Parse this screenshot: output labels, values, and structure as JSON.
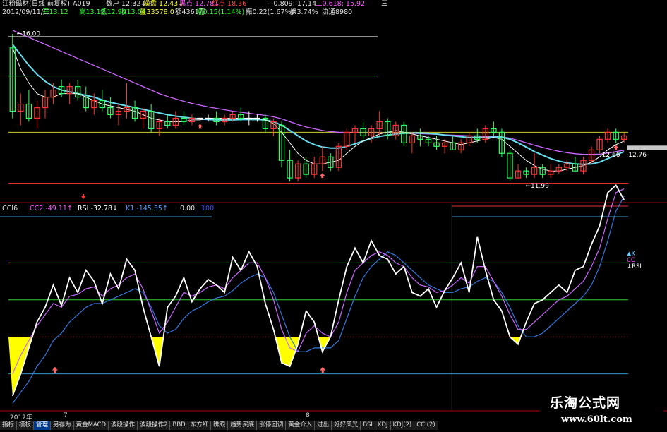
{
  "header": {
    "line1": [
      {
        "text": "江粉磁材(日线 前复权)",
        "color": "#e0e0e0"
      },
      {
        "text": "A019",
        "color": "#e0e0e0"
      },
      {
        "text": "数户 12:32↓",
        "color": "#e0e0e0"
      },
      {
        "text": "操盘 12.43↓",
        "color": "#ffff33"
      },
      {
        "text": "黑点 12.78↓",
        "color": "#ff55ff"
      },
      {
        "text": "红点 18.36",
        "color": "#ff4444"
      },
      {
        "text": "—0.809: 17.14",
        "color": "#e0e0e0"
      },
      {
        "text": "二0.618: 15.92",
        "color": "#ff55ff"
      },
      {
        "text": "三",
        "color": "#e0e0e0"
      }
    ],
    "line2": [
      {
        "text": "2012/09/11/二",
        "color": "#e0e0e0"
      },
      {
        "text": "开13.12",
        "color": "#33ff33"
      },
      {
        "text": "高13.12",
        "color": "#33ff33"
      },
      {
        "text": "低12.90",
        "color": "#33ff33"
      },
      {
        "text": "收13.04",
        "color": "#33ff33"
      },
      {
        "text": "量33578.0",
        "color": "#ffff33"
      },
      {
        "text": "额4361万",
        "color": "#e0e0e0"
      },
      {
        "text": "幅0.15(1.14%)",
        "color": "#33ff33"
      },
      {
        "text": "振0.22(1.67%)",
        "color": "#e0e0e0"
      },
      {
        "text": "换3.74%",
        "color": "#e0e0e0"
      },
      {
        "text": "流通8980",
        "color": "#e0e0e0"
      }
    ]
  },
  "indicator_header": [
    {
      "text": "CCI6",
      "color": "#e0e0e0"
    },
    {
      "text": "CC2 -49.11↑",
      "color": "#ff55ff"
    },
    {
      "text": "RSI -32.78↓",
      "color": "#ffffff"
    },
    {
      "text": "K1 -145.35↑",
      "color": "#5599ff"
    },
    {
      "text": "0.00",
      "color": "#e0e0e0"
    },
    {
      "text": "100",
      "color": "#3355ff"
    }
  ],
  "axis_labels": {
    "year": "2012年",
    "m7": "7",
    "m8": "8"
  },
  "tabs": [
    {
      "label": "指标",
      "active": false
    },
    {
      "label": "模板",
      "active": false
    },
    {
      "label": "管理",
      "active": true
    },
    {
      "label": "另存为",
      "active": false
    },
    {
      "label": "黄金MACD",
      "active": false
    },
    {
      "label": "波段操作",
      "active": false
    },
    {
      "label": "波段操作2",
      "active": false
    },
    {
      "label": "BBD",
      "active": false
    },
    {
      "label": "东方红",
      "active": false
    },
    {
      "label": "瞧眼",
      "active": false
    },
    {
      "label": "趋势买底",
      "active": false
    },
    {
      "label": "涨停回调",
      "active": false
    },
    {
      "label": "黄金介入",
      "active": false
    },
    {
      "label": "进出",
      "active": false
    },
    {
      "label": "好好风光",
      "active": false
    },
    {
      "label": "BSI",
      "active": false
    },
    {
      "label": "KDJ",
      "active": false
    },
    {
      "label": "KDJ(2)",
      "active": false
    },
    {
      "label": "CCI(2)",
      "active": false
    }
  ],
  "watermark": {
    "title": "乐淘公式网",
    "url": "www.60lt.com"
  },
  "chart_data": [
    {
      "type": "candlestick",
      "title": "江粉磁材(日线 前复权)",
      "ylim": [
        11.3,
        16.4
      ],
      "annotations": [
        "16.00",
        "12.66",
        "12.76",
        "11.99"
      ],
      "colors": {
        "up": "#ff3333",
        "down": "#33ff66",
        "doji": "#ffffff",
        "ma_fast": "#ffffff",
        "ma_mid": "#66ddee",
        "ma_slow": "#cc66ff"
      },
      "horizontal_levels": [
        {
          "value": 15.92,
          "color": "#e0e0e0"
        },
        {
          "value": 14.8,
          "color": "#33cc33"
        },
        {
          "value": 13.2,
          "color": "#cccc33"
        },
        {
          "value": 11.75,
          "color": "#ff3333"
        }
      ],
      "candles": [
        {
          "o": 15.6,
          "h": 16.0,
          "l": 13.6,
          "c": 13.8
        },
        {
          "o": 13.8,
          "h": 14.3,
          "l": 13.4,
          "c": 14.0
        },
        {
          "o": 14.0,
          "h": 14.4,
          "l": 13.5,
          "c": 13.6
        },
        {
          "o": 13.6,
          "h": 14.1,
          "l": 13.3,
          "c": 13.9
        },
        {
          "o": 13.9,
          "h": 14.4,
          "l": 13.6,
          "c": 14.2
        },
        {
          "o": 14.2,
          "h": 14.6,
          "l": 14.0,
          "c": 14.4
        },
        {
          "o": 14.5,
          "h": 14.7,
          "l": 14.2,
          "c": 14.3
        },
        {
          "o": 14.3,
          "h": 14.6,
          "l": 14.0,
          "c": 14.5
        },
        {
          "o": 14.5,
          "h": 14.7,
          "l": 14.1,
          "c": 14.2
        },
        {
          "o": 14.2,
          "h": 14.5,
          "l": 13.8,
          "c": 13.9
        },
        {
          "o": 13.9,
          "h": 14.3,
          "l": 13.7,
          "c": 14.1
        },
        {
          "o": 14.1,
          "h": 14.4,
          "l": 13.8,
          "c": 13.9
        },
        {
          "o": 13.9,
          "h": 14.2,
          "l": 13.6,
          "c": 13.7
        },
        {
          "o": 13.7,
          "h": 14.0,
          "l": 13.4,
          "c": 13.8
        },
        {
          "o": 13.8,
          "h": 14.6,
          "l": 13.6,
          "c": 13.9
        },
        {
          "o": 13.9,
          "h": 14.1,
          "l": 13.5,
          "c": 13.6
        },
        {
          "o": 13.6,
          "h": 13.9,
          "l": 13.3,
          "c": 13.8
        },
        {
          "o": 13.8,
          "h": 14.0,
          "l": 13.2,
          "c": 13.3
        },
        {
          "o": 13.3,
          "h": 13.6,
          "l": 13.1,
          "c": 13.5
        },
        {
          "o": 13.5,
          "h": 13.7,
          "l": 13.3,
          "c": 13.4
        },
        {
          "o": 13.4,
          "h": 13.8,
          "l": 13.3,
          "c": 13.6
        },
        {
          "o": 13.6,
          "h": 13.8,
          "l": 13.4,
          "c": 13.5
        },
        {
          "o": 13.5,
          "h": 13.7,
          "l": 13.4,
          "c": 13.6
        },
        {
          "o": 13.6,
          "h": 13.7,
          "l": 13.5,
          "c": 13.6
        },
        {
          "o": 13.6,
          "h": 13.7,
          "l": 13.5,
          "c": 13.6
        },
        {
          "o": 13.6,
          "h": 13.8,
          "l": 13.4,
          "c": 13.5
        },
        {
          "o": 13.5,
          "h": 13.7,
          "l": 13.4,
          "c": 13.6
        },
        {
          "o": 13.6,
          "h": 13.8,
          "l": 13.5,
          "c": 13.7
        },
        {
          "o": 13.7,
          "h": 13.9,
          "l": 13.5,
          "c": 13.6
        },
        {
          "o": 13.6,
          "h": 13.8,
          "l": 13.4,
          "c": 13.6
        },
        {
          "o": 13.6,
          "h": 13.7,
          "l": 13.5,
          "c": 13.6
        },
        {
          "o": 13.6,
          "h": 13.7,
          "l": 13.2,
          "c": 13.3
        },
        {
          "o": 13.3,
          "h": 13.6,
          "l": 13.1,
          "c": 13.5
        },
        {
          "o": 13.4,
          "h": 13.5,
          "l": 12.2,
          "c": 12.4
        },
        {
          "o": 12.4,
          "h": 12.7,
          "l": 11.8,
          "c": 11.9
        },
        {
          "o": 11.9,
          "h": 12.4,
          "l": 11.8,
          "c": 12.3
        },
        {
          "o": 12.3,
          "h": 12.5,
          "l": 11.9,
          "c": 12.0
        },
        {
          "o": 12.0,
          "h": 12.5,
          "l": 11.9,
          "c": 12.3
        },
        {
          "o": 12.3,
          "h": 12.8,
          "l": 12.1,
          "c": 12.5
        },
        {
          "o": 12.5,
          "h": 12.6,
          "l": 12.1,
          "c": 12.2
        },
        {
          "o": 12.2,
          "h": 12.9,
          "l": 12.1,
          "c": 12.8
        },
        {
          "o": 12.8,
          "h": 13.3,
          "l": 12.7,
          "c": 13.2
        },
        {
          "o": 13.2,
          "h": 13.4,
          "l": 12.9,
          "c": 13.3
        },
        {
          "o": 13.3,
          "h": 13.5,
          "l": 13.0,
          "c": 13.1
        },
        {
          "o": 13.1,
          "h": 13.4,
          "l": 12.9,
          "c": 13.3
        },
        {
          "o": 13.3,
          "h": 13.8,
          "l": 13.1,
          "c": 13.5
        },
        {
          "o": 13.5,
          "h": 13.6,
          "l": 13.0,
          "c": 13.1
        },
        {
          "o": 13.1,
          "h": 13.5,
          "l": 13.0,
          "c": 13.4
        },
        {
          "o": 13.4,
          "h": 13.5,
          "l": 12.8,
          "c": 12.9
        },
        {
          "o": 12.9,
          "h": 13.2,
          "l": 12.6,
          "c": 13.1
        },
        {
          "o": 13.1,
          "h": 13.3,
          "l": 12.8,
          "c": 13.0
        },
        {
          "o": 13.0,
          "h": 13.1,
          "l": 12.8,
          "c": 12.9
        },
        {
          "o": 12.9,
          "h": 13.1,
          "l": 12.7,
          "c": 12.8
        },
        {
          "o": 12.8,
          "h": 13.0,
          "l": 12.6,
          "c": 12.9
        },
        {
          "o": 12.9,
          "h": 13.1,
          "l": 12.7,
          "c": 12.7
        },
        {
          "o": 12.7,
          "h": 13.0,
          "l": 12.6,
          "c": 12.9
        },
        {
          "o": 12.9,
          "h": 13.2,
          "l": 12.8,
          "c": 13.1
        },
        {
          "o": 13.1,
          "h": 13.3,
          "l": 12.9,
          "c": 13.0
        },
        {
          "o": 13.0,
          "h": 13.4,
          "l": 12.9,
          "c": 13.3
        },
        {
          "o": 13.3,
          "h": 13.5,
          "l": 13.1,
          "c": 13.2
        },
        {
          "o": 13.2,
          "h": 13.3,
          "l": 12.5,
          "c": 12.6
        },
        {
          "o": 12.6,
          "h": 12.7,
          "l": 11.8,
          "c": 11.9
        },
        {
          "o": 11.9,
          "h": 12.3,
          "l": 11.9,
          "c": 12.1
        },
        {
          "o": 12.1,
          "h": 12.2,
          "l": 11.9,
          "c": 12.0
        },
        {
          "o": 12.0,
          "h": 12.6,
          "l": 11.9,
          "c": 12.2
        },
        {
          "o": 12.2,
          "h": 12.3,
          "l": 11.9,
          "c": 12.0
        },
        {
          "o": 12.0,
          "h": 12.3,
          "l": 11.9,
          "c": 12.1
        },
        {
          "o": 12.1,
          "h": 12.3,
          "l": 12.0,
          "c": 12.2
        },
        {
          "o": 12.2,
          "h": 12.4,
          "l": 12.1,
          "c": 12.3
        },
        {
          "o": 12.3,
          "h": 12.5,
          "l": 12.1,
          "c": 12.1
        },
        {
          "o": 12.1,
          "h": 12.5,
          "l": 12.0,
          "c": 12.4
        },
        {
          "o": 12.4,
          "h": 12.8,
          "l": 12.3,
          "c": 12.7
        },
        {
          "o": 12.7,
          "h": 13.1,
          "l": 12.6,
          "c": 13.0
        },
        {
          "o": 13.0,
          "h": 13.3,
          "l": 12.9,
          "c": 13.2
        },
        {
          "o": 13.2,
          "h": 13.3,
          "l": 12.9,
          "c": 13.0
        },
        {
          "o": 13.0,
          "h": 13.2,
          "l": 12.9,
          "c": 13.1
        }
      ],
      "ma_fast": [
        15.6,
        15.0,
        14.6,
        14.3,
        14.2,
        14.2,
        14.3,
        14.3,
        14.3,
        14.2,
        14.1,
        14.0,
        13.95,
        13.9,
        13.85,
        13.8,
        13.7,
        13.6,
        13.55,
        13.5,
        13.5,
        13.5,
        13.55,
        13.55,
        13.6,
        13.6,
        13.6,
        13.6,
        13.6,
        13.6,
        13.6,
        13.55,
        13.45,
        13.2,
        12.9,
        12.6,
        12.4,
        12.3,
        12.3,
        12.35,
        12.4,
        12.6,
        12.8,
        12.95,
        13.05,
        13.15,
        13.2,
        13.25,
        13.2,
        13.15,
        13.1,
        13.05,
        13.0,
        12.95,
        12.9,
        12.85,
        12.9,
        12.95,
        13.0,
        13.05,
        13.0,
        12.8,
        12.6,
        12.4,
        12.25,
        12.15,
        12.1,
        12.1,
        12.15,
        12.2,
        12.25,
        12.35,
        12.5,
        12.7,
        12.85,
        12.95
      ],
      "ma_mid": [
        15.7,
        15.4,
        15.1,
        14.85,
        14.65,
        14.5,
        14.4,
        14.35,
        14.3,
        14.25,
        14.2,
        14.12,
        14.05,
        14.0,
        13.95,
        13.9,
        13.85,
        13.8,
        13.75,
        13.7,
        13.66,
        13.63,
        13.6,
        13.58,
        13.56,
        13.55,
        13.55,
        13.55,
        13.56,
        13.56,
        13.56,
        13.55,
        13.5,
        13.4,
        13.25,
        13.1,
        12.95,
        12.85,
        12.78,
        12.75,
        12.75,
        12.8,
        12.87,
        12.95,
        13.02,
        13.08,
        13.12,
        13.15,
        13.17,
        13.18,
        13.18,
        13.17,
        13.15,
        13.12,
        13.1,
        13.07,
        13.05,
        13.05,
        13.05,
        13.06,
        13.06,
        13.0,
        12.9,
        12.78,
        12.65,
        12.55,
        12.45,
        12.38,
        12.33,
        12.3,
        12.29,
        12.3,
        12.35,
        12.45,
        12.55,
        12.65
      ],
      "ma_slow": [
        16.1,
        16.0,
        15.9,
        15.8,
        15.7,
        15.6,
        15.5,
        15.4,
        15.3,
        15.2,
        15.1,
        15.0,
        14.9,
        14.8,
        14.7,
        14.6,
        14.5,
        14.4,
        14.3,
        14.22,
        14.15,
        14.08,
        14.02,
        13.97,
        13.92,
        13.88,
        13.84,
        13.8,
        13.77,
        13.74,
        13.71,
        13.68,
        13.64,
        13.58,
        13.5,
        13.42,
        13.35,
        13.3,
        13.25,
        13.22,
        13.2,
        13.19,
        13.18,
        13.18,
        13.18,
        13.18,
        13.18,
        13.18,
        13.18,
        13.17,
        13.16,
        13.15,
        13.14,
        13.13,
        13.12,
        13.11,
        13.1,
        13.09,
        13.08,
        13.08,
        13.07,
        13.03,
        12.97,
        12.9,
        12.83,
        12.77,
        12.71,
        12.66,
        12.62,
        12.59,
        12.57,
        12.57,
        12.58,
        12.61,
        12.65,
        12.69
      ]
    },
    {
      "type": "line",
      "title": "CCI6",
      "ylim": [
        -300,
        200
      ],
      "reference_levels": [
        {
          "value": 100,
          "color": "#33cc33"
        },
        {
          "value": 0,
          "color": "#33cc33"
        },
        {
          "value": -200,
          "color": "#3399cc"
        }
      ],
      "legend_labels": [
        "▲K",
        "CC",
        "↓RSI"
      ],
      "series": [
        {
          "name": "RSI",
          "color": "#ffffff",
          "values": [
            -260,
            -200,
            -130,
            -60,
            -20,
            40,
            -15,
            60,
            20,
            80,
            50,
            -10,
            70,
            30,
            110,
            80,
            -20,
            -100,
            -180,
            -20,
            10,
            60,
            -5,
            30,
            55,
            40,
            20,
            115,
            80,
            130,
            90,
            -10,
            -80,
            -170,
            -180,
            -120,
            -30,
            -60,
            -140,
            -100,
            0,
            90,
            140,
            100,
            160,
            120,
            110,
            70,
            90,
            20,
            10,
            30,
            -20,
            25,
            60,
            100,
            20,
            170,
            80,
            0,
            -30,
            -100,
            -120,
            -60,
            -10,
            0,
            20,
            40,
            20,
            80,
            90,
            150,
            200,
            290,
            310,
            270
          ]
        },
        {
          "name": "CC2",
          "color": "#cc66ff",
          "values": [
            -200,
            -150,
            -110,
            -70,
            -40,
            -10,
            -20,
            10,
            15,
            30,
            35,
            10,
            30,
            40,
            60,
            70,
            30,
            -30,
            -90,
            -60,
            -20,
            20,
            10,
            20,
            35,
            40,
            30,
            60,
            80,
            100,
            100,
            60,
            0,
            -80,
            -130,
            -140,
            -90,
            -70,
            -90,
            -100,
            -60,
            20,
            80,
            100,
            120,
            130,
            120,
            100,
            90,
            60,
            40,
            35,
            20,
            25,
            40,
            60,
            45,
            90,
            90,
            50,
            10,
            -40,
            -80,
            -80,
            -60,
            -40,
            -20,
            0,
            10,
            30,
            50,
            90,
            140,
            220,
            290,
            300
          ]
        },
        {
          "name": "K1",
          "color": "#3377dd",
          "values": [
            -280,
            -250,
            -220,
            -180,
            -150,
            -110,
            -90,
            -60,
            -40,
            -20,
            -10,
            -10,
            0,
            10,
            20,
            30,
            20,
            -20,
            -70,
            -90,
            -80,
            -50,
            -30,
            -20,
            -5,
            5,
            10,
            25,
            45,
            60,
            70,
            60,
            20,
            -40,
            -100,
            -140,
            -140,
            -130,
            -130,
            -130,
            -110,
            -50,
            10,
            60,
            90,
            110,
            130,
            120,
            100,
            80,
            60,
            40,
            30,
            20,
            20,
            30,
            35,
            50,
            60,
            50,
            20,
            -20,
            -70,
            -100,
            -100,
            -90,
            -70,
            -50,
            -30,
            -10,
            10,
            40,
            90,
            160,
            240,
            280
          ]
        }
      ]
    }
  ]
}
